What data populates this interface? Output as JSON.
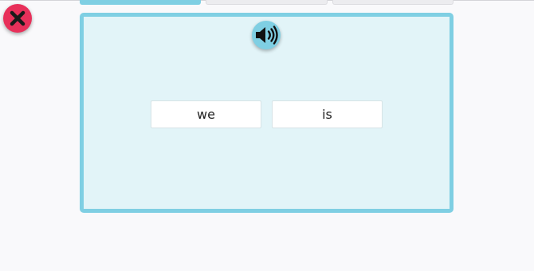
{
  "toolbar": {
    "close_icon": "close-icon",
    "close_color": "#e8305a"
  },
  "progress": {
    "total_steps": 3,
    "completed_steps": 1,
    "active_color": "#7fcfe3"
  },
  "card": {
    "audio_icon": "speaker-icon",
    "choices": [
      {
        "label": "we"
      },
      {
        "label": "is"
      }
    ]
  }
}
